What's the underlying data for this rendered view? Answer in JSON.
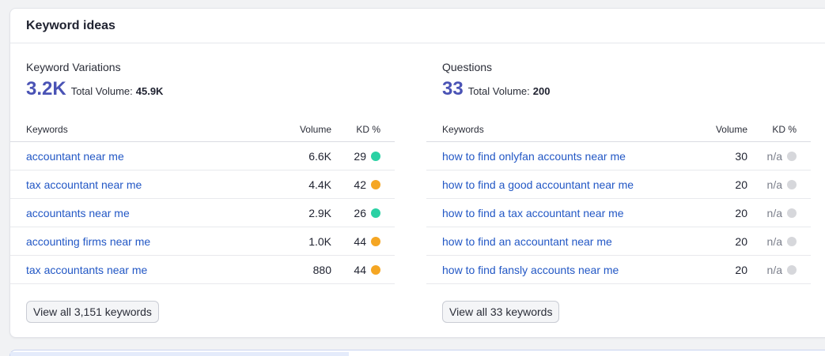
{
  "card": {
    "title": "Keyword ideas"
  },
  "variations": {
    "label": "Keyword Variations",
    "count": "3.2K",
    "total_label": "Total Volume:",
    "total_value": "45.9K",
    "headers": {
      "keywords": "Keywords",
      "volume": "Volume",
      "kd": "KD %"
    },
    "rows": [
      {
        "keyword": "accountant near me",
        "volume": "6.6K",
        "kd": "29",
        "kd_color": "#2bd1a4"
      },
      {
        "keyword": "tax accountant near me",
        "volume": "4.4K",
        "kd": "42",
        "kd_color": "#f5a623"
      },
      {
        "keyword": "accountants near me",
        "volume": "2.9K",
        "kd": "26",
        "kd_color": "#2bd1a4"
      },
      {
        "keyword": "accounting firms near me",
        "volume": "1.0K",
        "kd": "44",
        "kd_color": "#f5a623"
      },
      {
        "keyword": "tax accountants near me",
        "volume": "880",
        "kd": "44",
        "kd_color": "#f5a623"
      }
    ],
    "view_all_label": "View all 3,151 keywords"
  },
  "questions": {
    "label": "Questions",
    "count": "33",
    "total_label": "Total Volume:",
    "total_value": "200",
    "headers": {
      "keywords": "Keywords",
      "volume": "Volume",
      "kd": "KD %"
    },
    "rows": [
      {
        "keyword": "how to find onlyfan accounts near me",
        "volume": "30",
        "kd": "n/a",
        "kd_color": "#d6d7db"
      },
      {
        "keyword": "how to find a good accountant near me",
        "volume": "20",
        "kd": "n/a",
        "kd_color": "#d6d7db"
      },
      {
        "keyword": "how to find a tax accountant near me",
        "volume": "20",
        "kd": "n/a",
        "kd_color": "#d6d7db"
      },
      {
        "keyword": "how to find an accountant near me",
        "volume": "20",
        "kd": "n/a",
        "kd_color": "#d6d7db"
      },
      {
        "keyword": "how to find fansly accounts near me",
        "volume": "20",
        "kd": "n/a",
        "kd_color": "#d6d7db"
      }
    ],
    "view_all_label": "View all 33 keywords"
  },
  "colors": {
    "accent_number": "#4a53b5",
    "link": "#2257c5",
    "kd_easy": "#2bd1a4",
    "kd_medium": "#f5a623",
    "kd_na": "#d6d7db"
  }
}
